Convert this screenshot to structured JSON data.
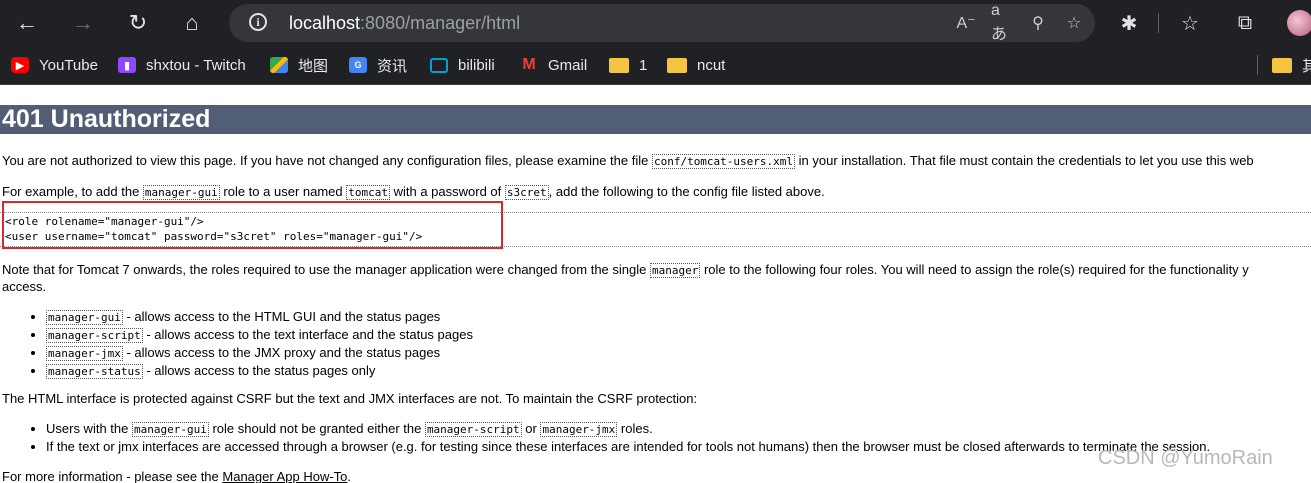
{
  "browser": {
    "url_host": "localhost",
    "url_rest": ":8080/manager/html",
    "bookmarks": [
      {
        "label": "YouTube",
        "icon": "youtube-icon"
      },
      {
        "label": "shxtou - Twitch",
        "icon": "twitch-icon"
      },
      {
        "label": "地图",
        "icon": "maps-icon"
      },
      {
        "label": "资讯",
        "icon": "news-icon"
      },
      {
        "label": "bilibili",
        "icon": "bilibili-icon"
      },
      {
        "label": "Gmail",
        "icon": "gmail-icon"
      },
      {
        "label": "1",
        "icon": "folder-icon"
      },
      {
        "label": "ncut",
        "icon": "folder-icon"
      },
      {
        "label": "其",
        "icon": "folder-icon"
      }
    ]
  },
  "page": {
    "title": "401 Unauthorized",
    "p1": {
      "text_before": "You are not authorized to view this page. If you have not changed any configuration files, please examine the file ",
      "code": "conf/tomcat-users.xml",
      "text_after": " in your installation. That file must contain the credentials to let you use this web"
    },
    "p2": {
      "t1": "For example, to add the ",
      "c1": "manager-gui",
      "t2": " role to a user named ",
      "c2": "tomcat",
      "t3": " with a password of ",
      "c3": "s3cret",
      "t4": ", add the following to the config file listed above."
    },
    "code_lines": [
      "<role rolename=\"manager-gui\"/>",
      "<user username=\"tomcat\" password=\"s3cret\" roles=\"manager-gui\"/>"
    ],
    "p3": {
      "t1": "Note that for Tomcat 7 onwards, the roles required to use the manager application were changed from the single ",
      "c1": "manager",
      "t2": " role to the following four roles. You will need to assign the role(s) required for the functionality y",
      "line2": "access."
    },
    "roles": [
      {
        "code": "manager-gui",
        "desc": " - allows access to the HTML GUI and the status pages"
      },
      {
        "code": "manager-script",
        "desc": " - allows access to the text interface and the status pages"
      },
      {
        "code": "manager-jmx",
        "desc": " - allows access to the JMX proxy and the status pages"
      },
      {
        "code": "manager-status",
        "desc": " - allows access to the status pages only"
      }
    ],
    "p4": "The HTML interface is protected against CSRF but the text and JMX interfaces are not. To maintain the CSRF protection:",
    "csrf1": {
      "t1": "Users with the ",
      "c1": "manager-gui",
      "t2": " role should not be granted either the ",
      "c2": "manager-script",
      "t3": " or ",
      "c3": "manager-jmx",
      "t4": " roles."
    },
    "csrf2": "If the text or jmx interfaces are accessed through a browser (e.g. for testing since these interfaces are intended for tools not humans) then the browser must be closed afterwards to terminate the session.",
    "p5": {
      "t1": "For more information - please see the ",
      "link": "Manager App How-To",
      "t2": "."
    }
  },
  "watermark": "CSDN @YumoRain",
  "colors": {
    "title_bg": "#525d76",
    "highlight_border": "#d9282f",
    "chrome_bg": "#202124"
  }
}
